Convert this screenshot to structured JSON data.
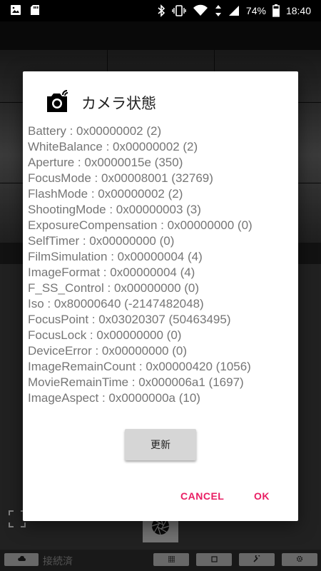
{
  "status_bar": {
    "battery_percent": "74%",
    "time": "18:40",
    "icons": [
      "image-icon",
      "sd-card-icon",
      "bluetooth-icon",
      "vibrate-icon",
      "wifi-icon",
      "data-arrows-icon",
      "signal-icon",
      "battery-icon"
    ]
  },
  "background": {
    "connection_status": "接続済"
  },
  "dialog": {
    "title": "カメラ状態",
    "title_icon": "camera-status-icon",
    "lines": [
      "Battery : 0x00000002 (2)",
      "WhiteBalance : 0x00000002 (2)",
      "Aperture : 0x0000015e (350)",
      "FocusMode : 0x00008001 (32769)",
      "FlashMode : 0x00000002 (2)",
      "ShootingMode : 0x00000003 (3)",
      "ExposureCompensation : 0x00000000 (0)",
      "SelfTimer : 0x00000000 (0)",
      "FilmSimulation : 0x00000004 (4)",
      "ImageFormat : 0x00000004 (4)",
      "F_SS_Control : 0x00000000 (0)",
      "Iso : 0x80000640 (-2147482048)",
      "FocusPoint : 0x03020307 (50463495)",
      "FocusLock : 0x00000000 (0)",
      "DeviceError : 0x00000000 (0)",
      "ImageRemainCount : 0x00000420 (1056)",
      "MovieRemainTime : 0x000006a1 (1697)",
      "ImageAspect : 0x0000000a (10)"
    ],
    "refresh_label": "更新",
    "cancel_label": "CANCEL",
    "ok_label": "OK",
    "accent_color": "#e91e63"
  }
}
